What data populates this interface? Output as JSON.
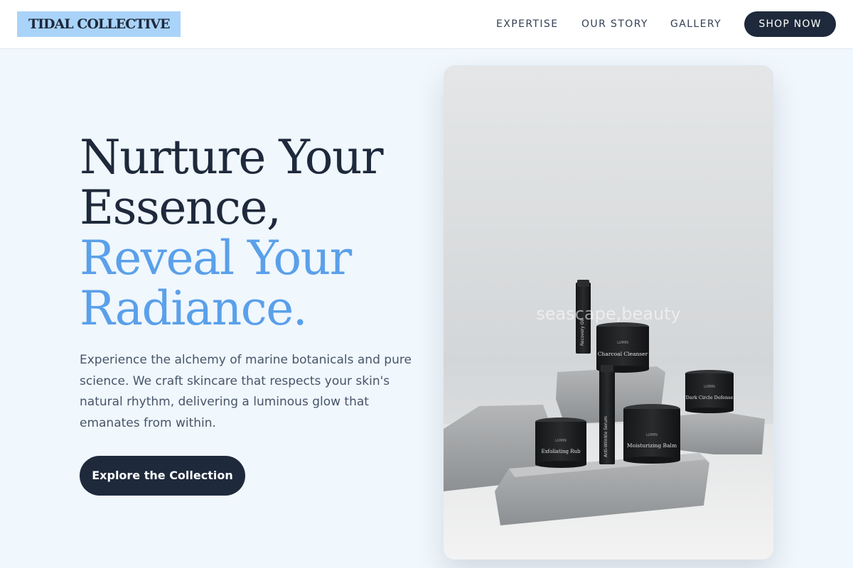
{
  "brand": {
    "name": "TIDAL COLLECTIVE"
  },
  "nav": {
    "items": [
      "EXPERTISE",
      "OUR STORY",
      "GALLERY"
    ],
    "cta_label": "SHOP NOW"
  },
  "hero": {
    "headline_line1": "Nurture Your",
    "headline_line2": "Essence,",
    "headline_line3": "Reveal Your",
    "headline_line4": "Radiance.",
    "body": "Experience the alchemy of marine botanicals and pure science. We craft skincare that respects your skin's natural rhythm, delivering a luminous glow that emanates from within.",
    "cta_label": "Explore the Collection",
    "image_watermark": "seascape,beauty"
  },
  "products": {
    "brand_mark": "LUMIN",
    "items": [
      "Recovery Oil",
      "Charcoal Cleanser",
      "Anti-Wrinkle Serum",
      "Exfoliating Rub",
      "Moisturizing Balm",
      "Dark Circle Defense"
    ]
  },
  "colors": {
    "navy": "#1e293b",
    "accent_blue": "#5aa0ea",
    "logo_bg": "#a9d3f9",
    "page_bg": "#f0f7fd"
  }
}
